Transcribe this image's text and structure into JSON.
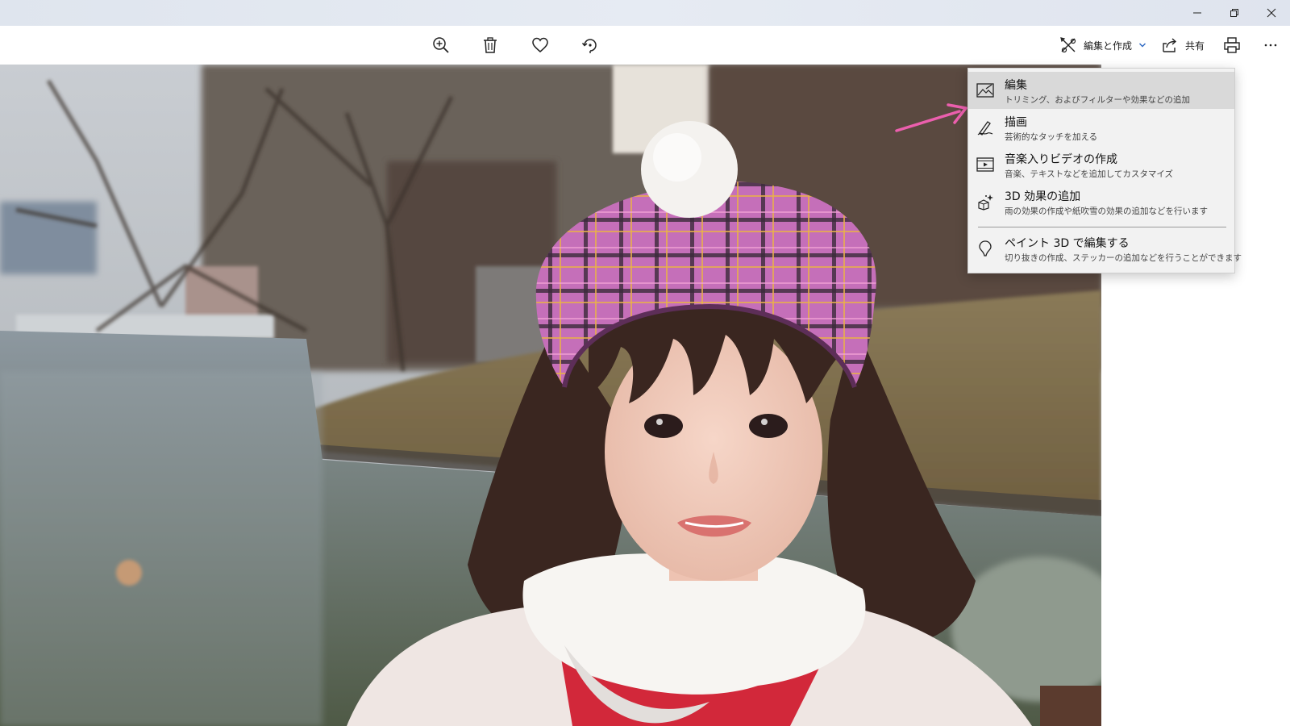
{
  "titlebar": {
    "buttons": [
      {
        "name": "minimize-button",
        "icon": "minimize-icon"
      },
      {
        "name": "restore-button",
        "icon": "restore-icon"
      },
      {
        "name": "close-button",
        "icon": "close-icon"
      }
    ]
  },
  "toolbar": {
    "icons": [
      "zoom-in-icon",
      "delete-icon",
      "favorite-heart-icon",
      "rotate-icon"
    ],
    "edit_create_label": "編集と作成",
    "share_label": "共有",
    "print_icon": "print-icon",
    "more_icon": "more-icon"
  },
  "menu": {
    "items": [
      {
        "title": "編集",
        "subtitle": "トリミング、およびフィルターや効果などの追加",
        "icon": "edit-image-icon",
        "highlighted": true
      },
      {
        "title": "描画",
        "subtitle": "芸術的なタッチを加える",
        "icon": "pen-draw-icon",
        "highlighted": false
      },
      {
        "title": "音楽入りビデオの作成",
        "subtitle": "音楽、テキストなどを追加してカスタマイズ",
        "icon": "video-icon",
        "highlighted": false
      },
      {
        "title": "3D 効果の追加",
        "subtitle": "雨の効果の作成や紙吹雪の効果の追加などを行います",
        "icon": "3d-effects-icon",
        "highlighted": false
      },
      {
        "title": "ペイント 3D で編集する",
        "subtitle": "切り抜きの作成、ステッカーの追加などを行うことができます",
        "icon": "paint-3d-icon",
        "highlighted": false
      }
    ]
  },
  "colors": {
    "annotation_arrow": "#ec5fae",
    "menu_bg": "#f2f2f2",
    "menu_highlight": "#d9d9d9",
    "titlebar_bg": "#e2e7f0"
  }
}
